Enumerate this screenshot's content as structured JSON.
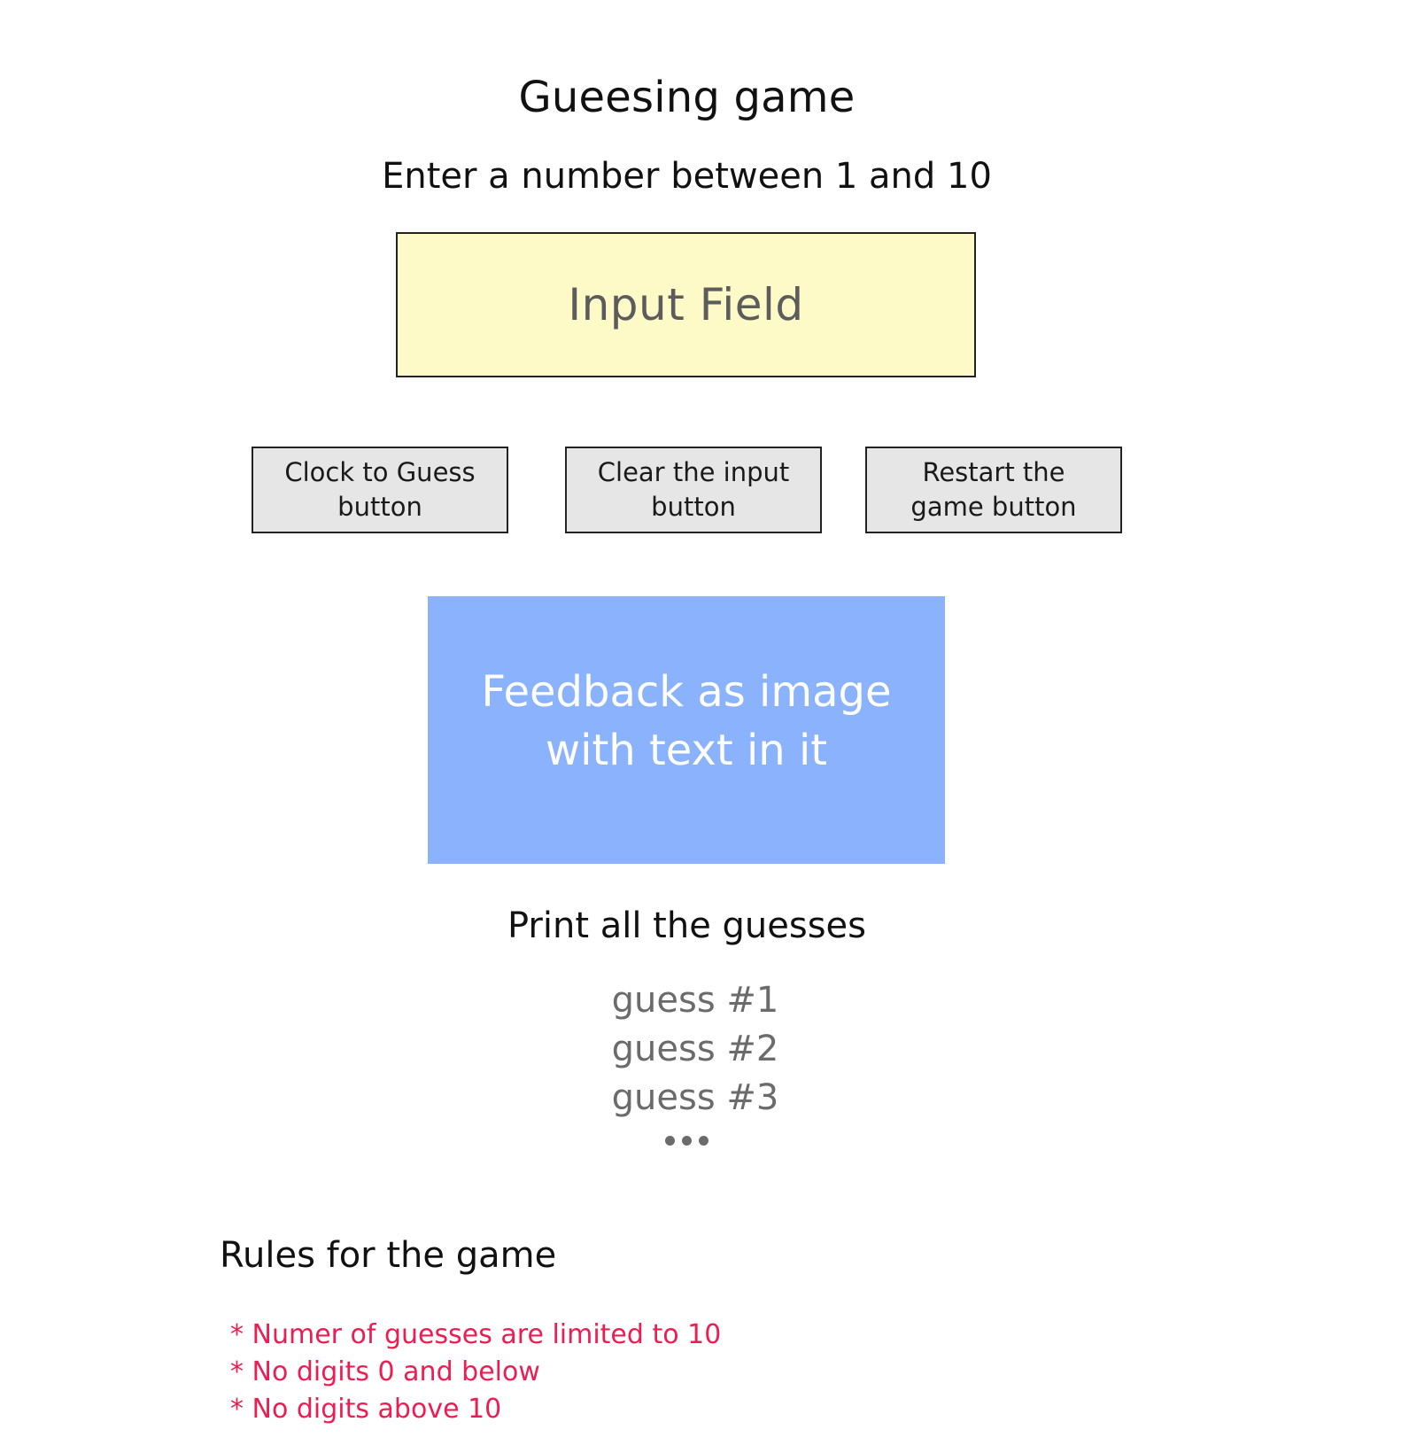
{
  "header": {
    "title": "Gueesing game",
    "instruction": "Enter a number between 1 and 10"
  },
  "input": {
    "label": "Input Field"
  },
  "buttons": {
    "guess": "Clock to Guess\nbutton",
    "clear": "Clear the input\nbutton",
    "restart": "Restart the\ngame button"
  },
  "feedback": {
    "text": "Feedback as image\nwith text in it"
  },
  "guesses": {
    "heading": "Print all the guesses",
    "items": [
      "guess #1",
      "guess #2",
      "guess #3"
    ]
  },
  "rules": {
    "heading": "Rules for the game",
    "items": [
      "* Numer of guesses are limited to 10",
      "* No digits 0 and below",
      "* No digits above 10"
    ]
  },
  "colors": {
    "input_bg": "#fefac8",
    "button_bg": "#e6e6e6",
    "feedback_bg": "#8bb2fd",
    "rules_text": "#ec1d52",
    "muted_text": "#6b6b6b"
  }
}
